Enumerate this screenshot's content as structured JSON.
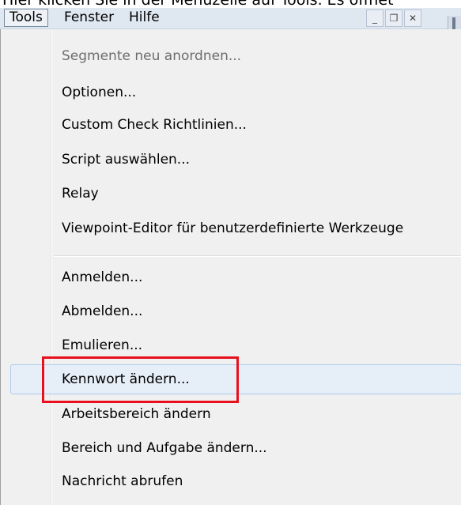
{
  "caption": "Hier klicken Sie in der Menüzeile auf Tools. Es öffnet",
  "menubar": {
    "items": [
      {
        "label": "Tools",
        "active": true
      },
      {
        "label": "Fenster"
      },
      {
        "label": "Hilfe"
      }
    ],
    "window_controls": [
      {
        "icon": "minimize-icon",
        "glyph": "_"
      },
      {
        "icon": "restore-icon",
        "glyph": "❐"
      },
      {
        "icon": "close-icon",
        "glyph": "✕"
      }
    ]
  },
  "menu": {
    "group1": [
      {
        "label": "Segmente neu anordnen...",
        "enabled": false
      },
      {
        "label": "Optionen..."
      },
      {
        "label": "Custom Check Richtlinien..."
      },
      {
        "label": "Script auswählen..."
      },
      {
        "label": "Relay"
      },
      {
        "label": "Viewpoint-Editor für benutzerdefinierte Werkzeuge"
      }
    ],
    "group2": [
      {
        "label": "Anmelden..."
      },
      {
        "label": "Abmelden..."
      },
      {
        "label": "Emulieren..."
      },
      {
        "label": "Kennwort ändern...",
        "hovered": true,
        "highlighted": true
      },
      {
        "label": "Arbeitsbereich ändern"
      },
      {
        "label": "Bereich und Aufgabe ändern..."
      },
      {
        "label": "Nachricht abrufen"
      }
    ]
  },
  "colors": {
    "highlight_border": "#e8101c",
    "hover_bg": "#e6eef8",
    "menu_bg": "#f0f0f0",
    "disabled_text": "#6d6d6d"
  }
}
